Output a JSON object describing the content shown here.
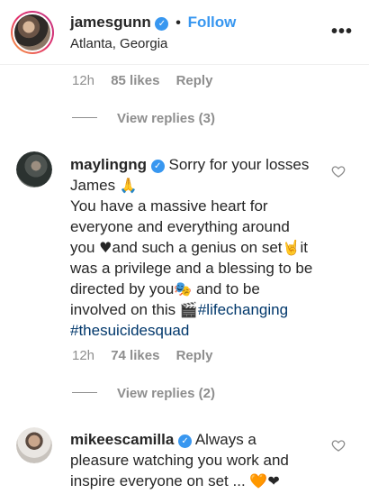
{
  "header": {
    "username": "jamesgunn",
    "verified_mark": "✓",
    "separator": "•",
    "follow_label": "Follow",
    "location": "Atlanta, Georgia",
    "more_label": "•••"
  },
  "first_comment_meta": {
    "time": "12h",
    "likes": "85 likes",
    "reply": "Reply"
  },
  "first_view_replies": "View replies (3)",
  "comment_mayling": {
    "username": "maylingng",
    "text_1": "Sorry for your losses James",
    "emoji_pray": "🙏",
    "text_2": "You have a massive heart for everyone and everything around you",
    "emoji_heart": "♥",
    "text_3": "and such a genius on set",
    "emoji_horns": "🤘",
    "text_4": "it was a privilege and a blessing to be directed by you",
    "emoji_mask": "🎭",
    "text_5": " and to be involved on this",
    "emoji_clapper": "🎬",
    "hashtag_1": "#lifechanging",
    "hashtag_2": "#thesuicidesquad",
    "meta": {
      "time": "12h",
      "likes": "74 likes",
      "reply": "Reply"
    },
    "view_replies": "View replies (2)"
  },
  "comment_mikee": {
    "username": "mikeescamilla",
    "text": "Always a pleasure watching you work and inspire everyone on set ...",
    "emoji_hearts": "🧡❤"
  },
  "colors": {
    "link": "#3897f0",
    "hashtag": "#00376b",
    "muted": "#8e8e8e",
    "text": "#262626"
  },
  "icons": [
    "verified-badge-icon",
    "more-options-icon",
    "heart-outline-icon"
  ]
}
